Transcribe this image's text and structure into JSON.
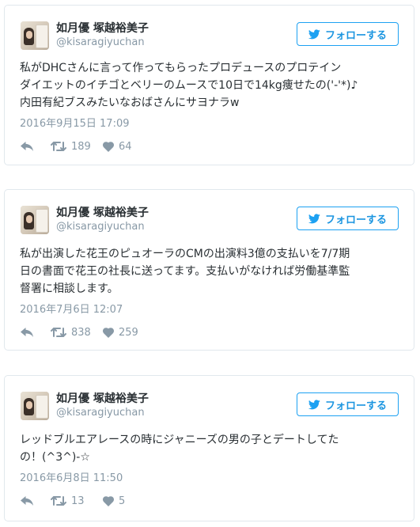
{
  "follow_label": "フォローする",
  "colors": {
    "accent": "#1da1f2",
    "text": "#292f33",
    "muted": "#8899a6",
    "border": "#e1e8ed"
  },
  "icons": {
    "reply": "reply-icon",
    "retweet": "retweet-icon",
    "like": "heart-icon",
    "follow": "twitter-bird-icon"
  },
  "tweets": [
    {
      "display_name": "如月優 塚越裕美子",
      "handle": "@kisaragiyuchan",
      "text_lines": [
        "私がDHCさんに言って作ってもらったプロデュースのプロテイン",
        "ダイエットのイチゴとベリーのムースで10日で14kg痩せたの('-'*)♪",
        "内田有紀ブスみたいなおばさんにサヨナラw"
      ],
      "timestamp": "2016年9月15日 17:09",
      "retweets": "189",
      "likes": "64"
    },
    {
      "display_name": "如月優 塚越裕美子",
      "handle": "@kisaragiyuchan",
      "text_lines": [
        "私が出演した花王のピュオーラのCMの出演料3億の支払いを7/7期",
        "日の書面で花王の社長に送ってます。支払いがなければ労働基準監",
        "督署に相談します。"
      ],
      "timestamp": "2016年7月6日 12:07",
      "retweets": "838",
      "likes": "259"
    },
    {
      "display_name": "如月優 塚越裕美子",
      "handle": "@kisaragiyuchan",
      "text_lines": [
        "レッドブルエアレースの時にジャニーズの男の子とデートしてた",
        "の！(^3^)-☆"
      ],
      "timestamp": "2016年6月8日 11:50",
      "retweets": "13",
      "likes": "5"
    }
  ]
}
